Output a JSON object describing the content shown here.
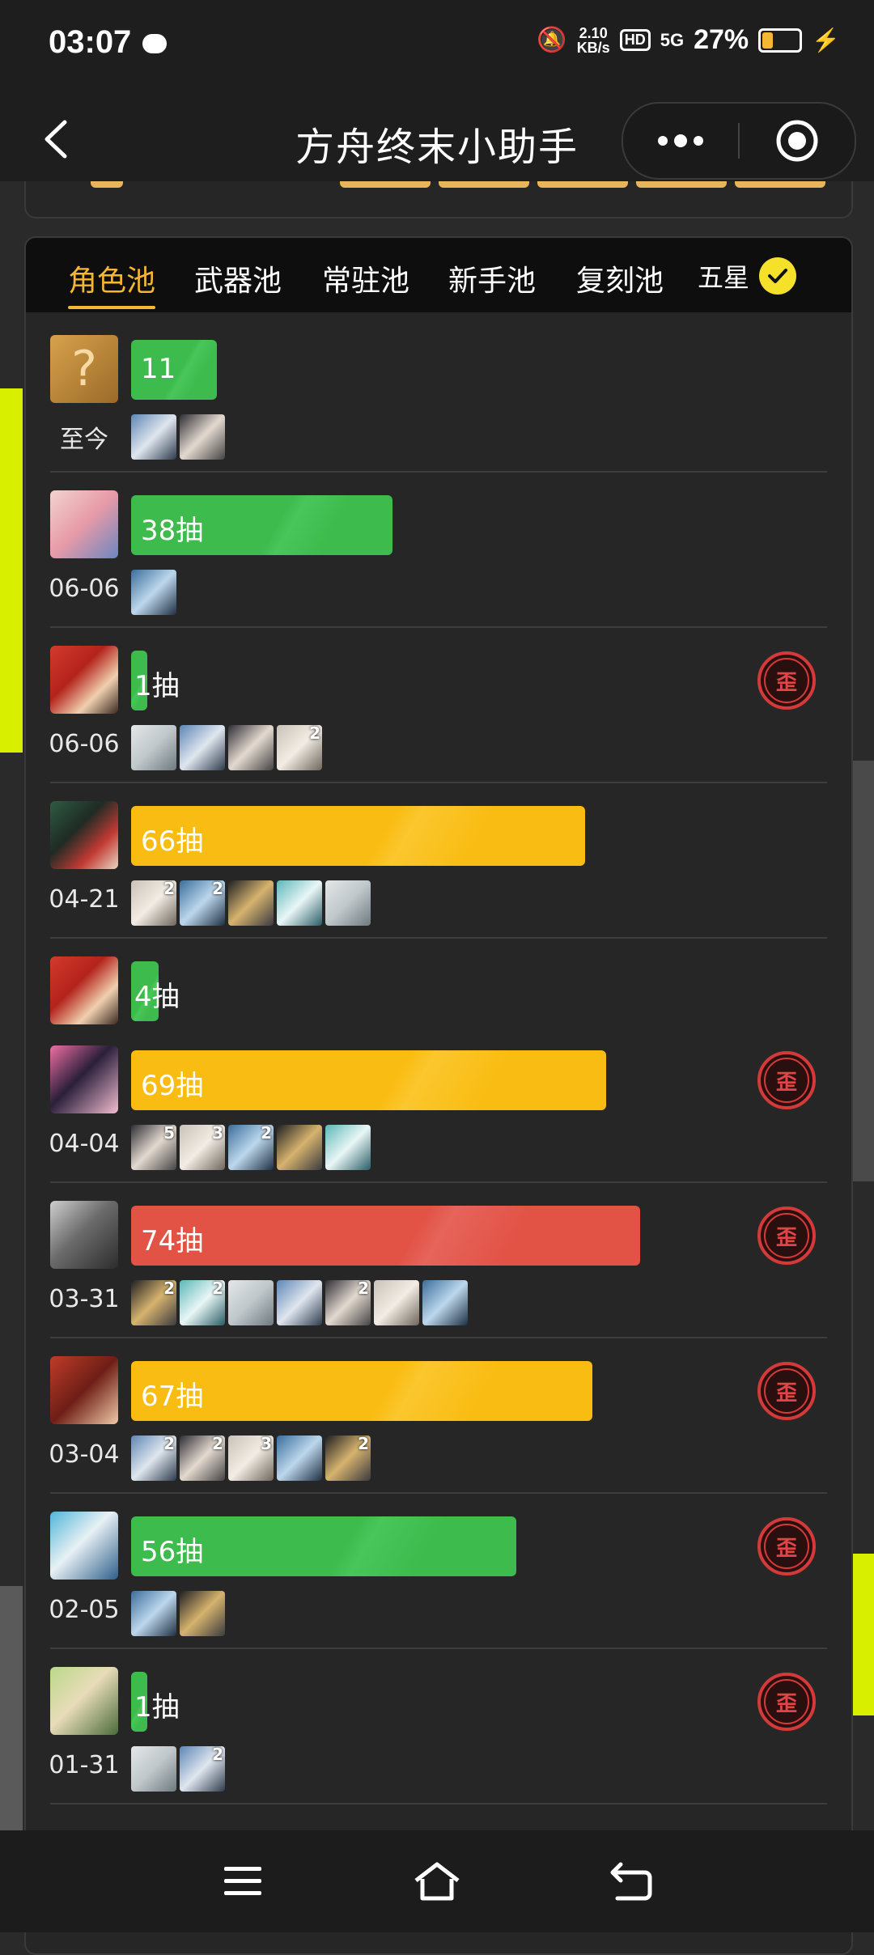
{
  "status": {
    "time": "03:07",
    "speed_top": "2.10",
    "speed_unit": "KB/s",
    "hd": "HD",
    "network": "5G",
    "battery": "27%",
    "battery_level": 0.27
  },
  "header": {
    "title": "方舟终末小助手"
  },
  "tabs": [
    {
      "label": "角色池",
      "active": true
    },
    {
      "label": "武器池",
      "active": false
    },
    {
      "label": "常驻池",
      "active": false
    },
    {
      "label": "新手池",
      "active": false
    },
    {
      "label": "复刻池",
      "active": false
    }
  ],
  "star_filter": {
    "label": "五星",
    "checked": true
  },
  "wai_label": "歪",
  "records": [
    {
      "avatar": "unknown",
      "avatar_symbol": "?",
      "bar_text": "11",
      "bar_pulls": 11,
      "bar_color": "green",
      "date": "至今",
      "minis": [
        {
          "count": ""
        },
        {
          "count": ""
        }
      ],
      "wai": false
    },
    {
      "avatar": "pink",
      "bar_text": "38抽",
      "bar_pulls": 38,
      "bar_color": "green",
      "date": "06-06",
      "minis": [
        {
          "count": ""
        }
      ],
      "wai": false
    },
    {
      "avatar": "red-hood",
      "bar_text": "1抽",
      "bar_pulls": 1,
      "bar_color": "green",
      "date": "06-06",
      "minis": [
        {
          "count": ""
        },
        {
          "count": ""
        },
        {
          "count": ""
        },
        {
          "count": "2"
        }
      ],
      "wai": true
    },
    {
      "avatar": "green-dark",
      "bar_text": "66抽",
      "bar_pulls": 66,
      "bar_color": "yellow",
      "date": "04-21",
      "minis": [
        {
          "count": "2"
        },
        {
          "count": "2"
        },
        {
          "count": ""
        },
        {
          "count": ""
        },
        {
          "count": ""
        }
      ],
      "wai": false
    },
    {
      "avatar": "red-hood",
      "bar_text": "4抽",
      "bar_pulls": 4,
      "bar_color": "green",
      "date": "",
      "minis": [],
      "wai": false
    },
    {
      "avatar": "pink-bright",
      "bar_text": "69抽",
      "bar_pulls": 69,
      "bar_color": "yellow",
      "date": "04-04",
      "minis": [
        {
          "count": "5"
        },
        {
          "count": "3"
        },
        {
          "count": "2"
        },
        {
          "count": ""
        },
        {
          "count": ""
        }
      ],
      "wai": true
    },
    {
      "avatar": "silver",
      "bar_text": "74抽",
      "bar_pulls": 74,
      "bar_color": "red",
      "date": "03-31",
      "minis": [
        {
          "count": "2"
        },
        {
          "count": "2"
        },
        {
          "count": ""
        },
        {
          "count": ""
        },
        {
          "count": "2"
        },
        {
          "count": ""
        },
        {
          "count": ""
        }
      ],
      "wai": true
    },
    {
      "avatar": "red-hair",
      "bar_text": "67抽",
      "bar_pulls": 67,
      "bar_color": "yellow",
      "date": "03-04",
      "minis": [
        {
          "count": "2"
        },
        {
          "count": "2"
        },
        {
          "count": "3"
        },
        {
          "count": ""
        },
        {
          "count": "2"
        }
      ],
      "wai": true
    },
    {
      "avatar": "blue-hair",
      "bar_text": "56抽",
      "bar_pulls": 56,
      "bar_color": "green",
      "date": "02-05",
      "minis": [
        {
          "count": ""
        },
        {
          "count": ""
        }
      ],
      "wai": true
    },
    {
      "avatar": "green-hair",
      "bar_text": "1抽",
      "bar_pulls": 1,
      "bar_color": "green",
      "date": "01-31",
      "minis": [
        {
          "count": ""
        },
        {
          "count": "2"
        }
      ],
      "wai": true
    }
  ],
  "colors": {
    "accent": "#f5b731",
    "green": "#3dbb4d",
    "yellow": "#f9bc12",
    "red": "#e25245",
    "wai": "#d43a3a"
  }
}
